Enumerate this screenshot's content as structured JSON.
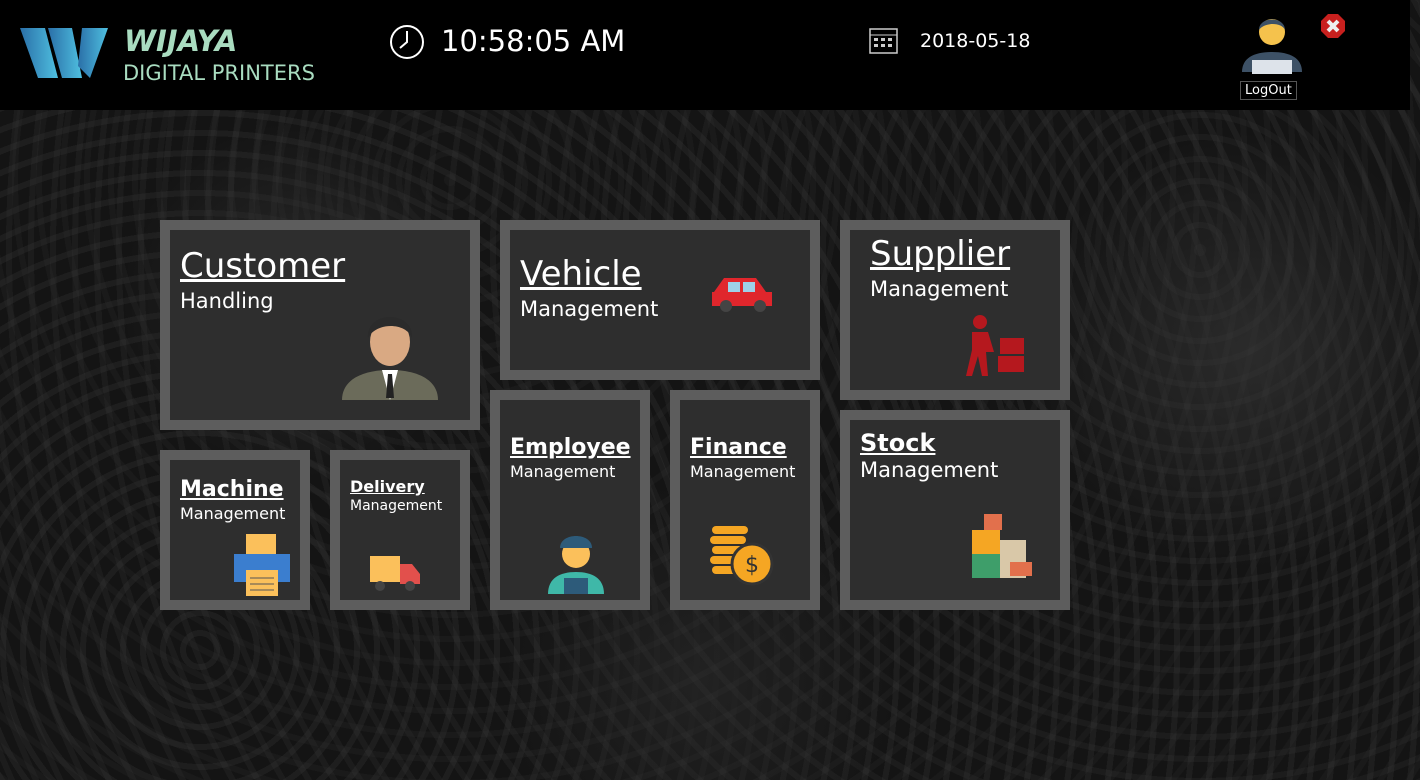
{
  "brand": {
    "name": "WIJAYA",
    "subtitle": "DIGITAL PRINTERS"
  },
  "header": {
    "time": "10:58:05 AM",
    "date": "2018-05-18",
    "logout_label": "LogOut"
  },
  "colors": {
    "tile_bg": "#2e2e2e",
    "tile_border": "#5d5d5d",
    "brand": "#a9dcc0"
  },
  "tiles": [
    {
      "title": "Customer",
      "subtitle": "Handling"
    },
    {
      "title": "Vehicle",
      "subtitle": "Management"
    },
    {
      "title": "Supplier",
      "subtitle": "Management"
    },
    {
      "title": "Machine",
      "subtitle": "Management"
    },
    {
      "title": "Delivery",
      "subtitle": "Management"
    },
    {
      "title": "Employee",
      "subtitle": "Management"
    },
    {
      "title": "Finance",
      "subtitle": "Management"
    },
    {
      "title": "Stock",
      "subtitle": "Management"
    }
  ]
}
